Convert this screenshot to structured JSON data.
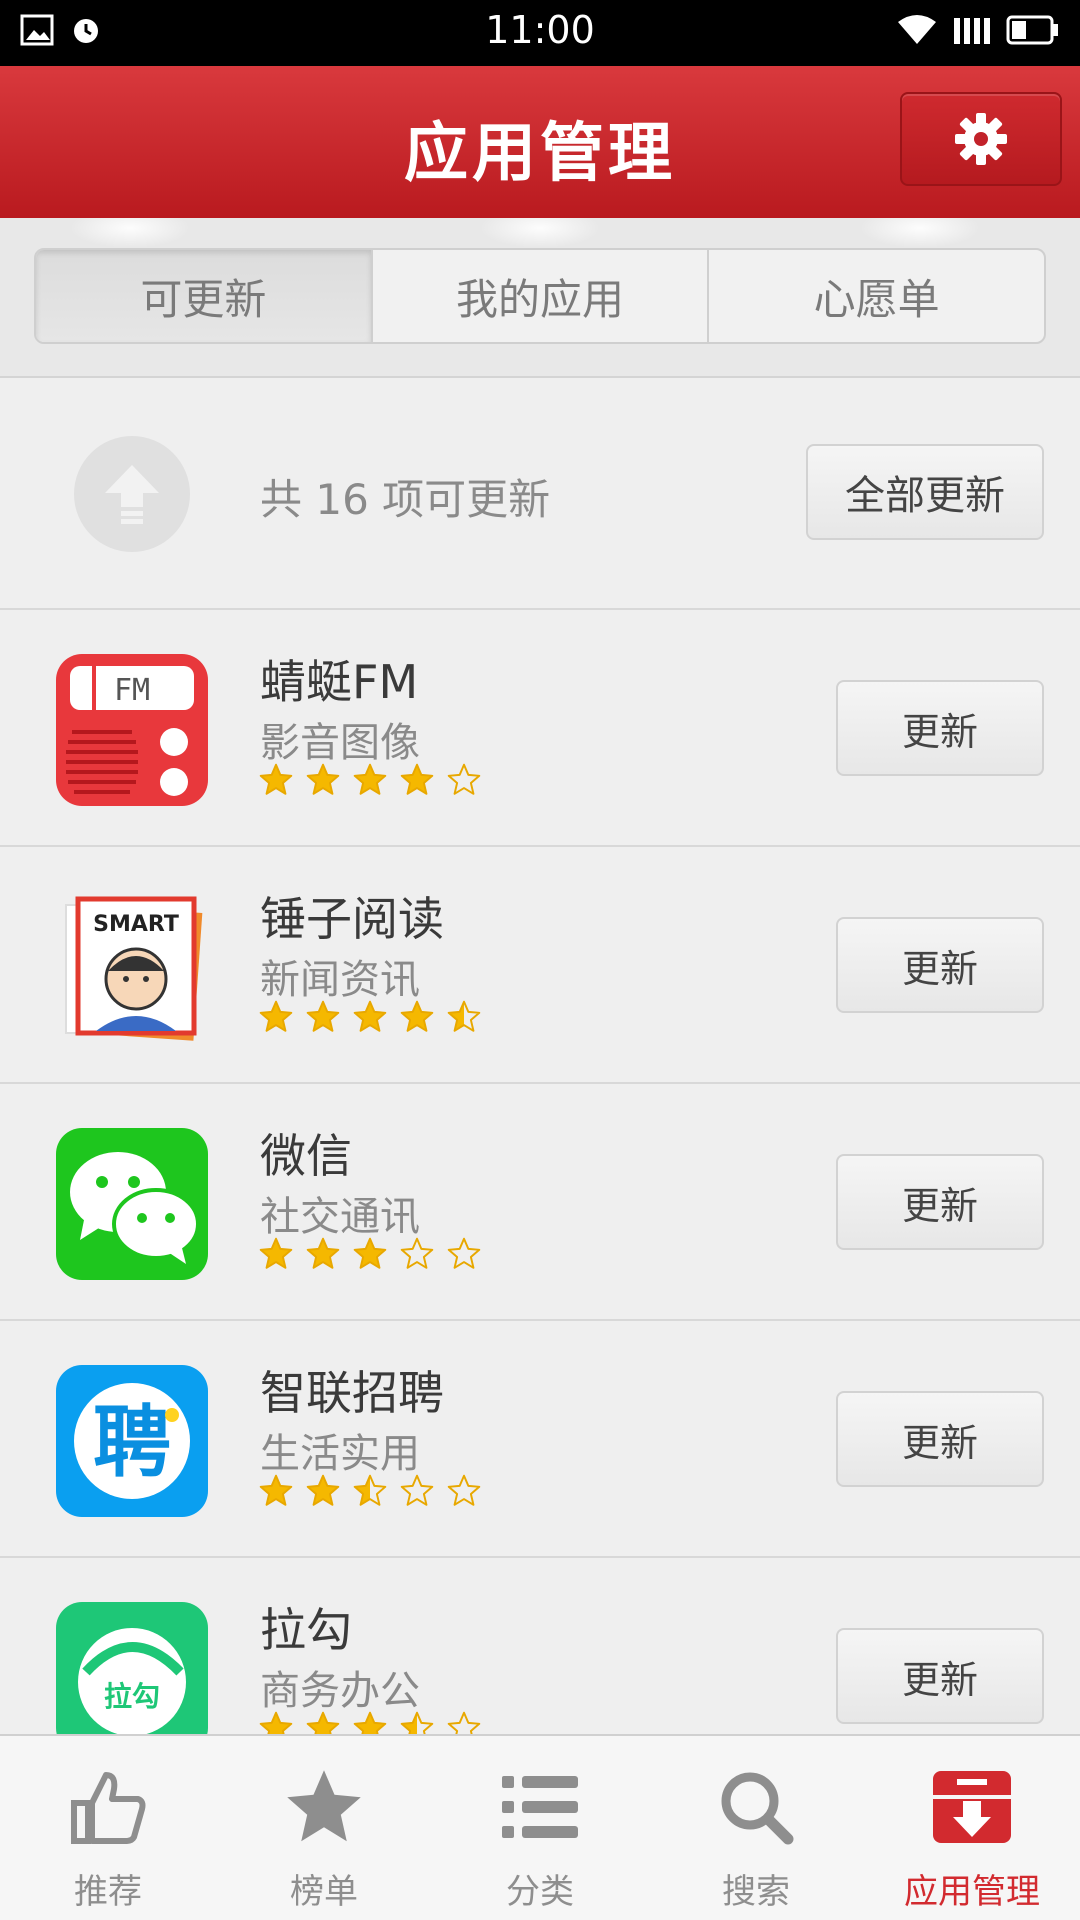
{
  "status_bar": {
    "time": "11:00",
    "icons_left": [
      "image-icon",
      "alarm-icon"
    ],
    "icons_right": [
      "wifi-icon",
      "signal-icon",
      "battery-icon"
    ]
  },
  "header": {
    "title": "应用管理",
    "settings_icon": "gear-icon"
  },
  "tabs": [
    {
      "label": "可更新",
      "active": true
    },
    {
      "label": "我的应用",
      "active": false
    },
    {
      "label": "心愿单",
      "active": false
    }
  ],
  "update_summary": {
    "count_text": "共 16 项可更新",
    "update_all_label": "全部更新"
  },
  "apps": [
    {
      "name": "蜻蜓FM",
      "category": "影音图像",
      "rating": 4,
      "update_label": "更新",
      "icon": "qingting-fm-icon",
      "icon_text": "FM"
    },
    {
      "name": "锤子阅读",
      "category": "新闻资讯",
      "rating": 4.5,
      "update_label": "更新",
      "icon": "smart-reader-icon",
      "icon_text": "SMART"
    },
    {
      "name": "微信",
      "category": "社交通讯",
      "rating": 3,
      "update_label": "更新",
      "icon": "wechat-icon",
      "icon_text": ""
    },
    {
      "name": "智联招聘",
      "category": "生活实用",
      "rating": 2.5,
      "update_label": "更新",
      "icon": "zhilian-icon",
      "icon_text": "聘"
    },
    {
      "name": "拉勾",
      "category": "商务办公",
      "rating": 3.5,
      "update_label": "更新",
      "icon": "lagou-icon",
      "icon_text": "拉勾"
    }
  ],
  "bottom_nav": [
    {
      "label": "推荐",
      "icon": "thumbs-up-icon",
      "active": false
    },
    {
      "label": "榜单",
      "icon": "star-icon",
      "active": false
    },
    {
      "label": "分类",
      "icon": "list-icon",
      "active": false
    },
    {
      "label": "搜索",
      "icon": "search-icon",
      "active": false
    },
    {
      "label": "应用管理",
      "icon": "app-manage-icon",
      "active": true
    }
  ],
  "colors": {
    "header_red": "#c8252a",
    "star_gold": "#f5b800",
    "active_nav": "#d22a2f"
  }
}
